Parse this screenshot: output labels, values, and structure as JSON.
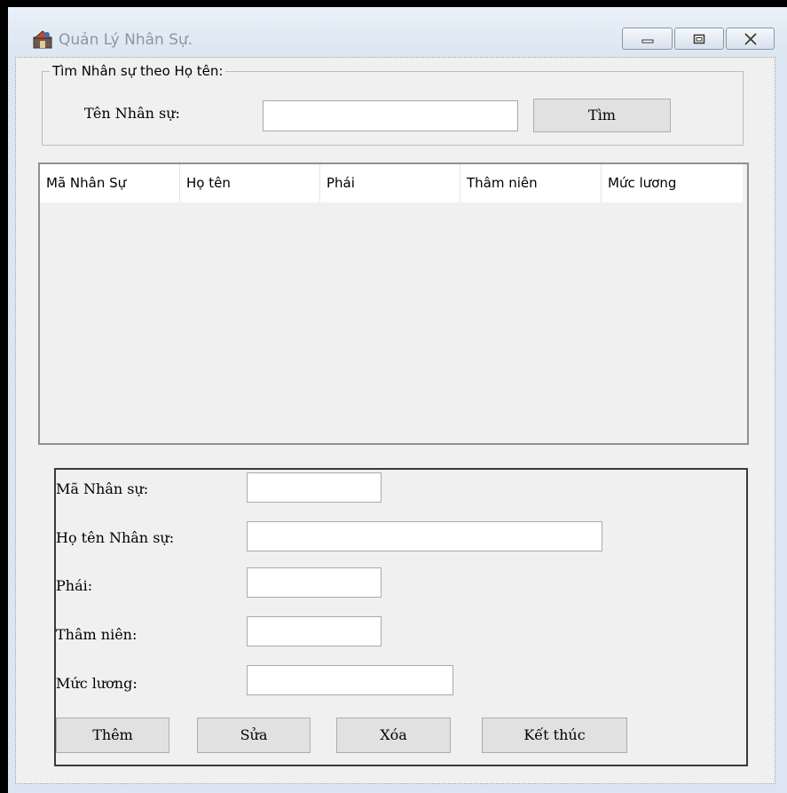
{
  "window": {
    "title": "Quản Lý Nhân Sự.",
    "controls": {
      "minimize": "minimize",
      "maximize": "maximize",
      "close": "close"
    }
  },
  "search": {
    "group_title": "Tìm Nhân sự theo Họ tên:",
    "label": "Tên Nhân sự:",
    "value": "",
    "button": "Tìm"
  },
  "list": {
    "columns": [
      "Mã Nhân Sự",
      "Họ tên",
      "Phái",
      "Thâm niên",
      "Mức lương"
    ],
    "rows": []
  },
  "details": {
    "ma_label": "Mã Nhân sự:",
    "ma_value": "",
    "hoten_label": "Họ tên Nhân sự:",
    "hoten_value": "",
    "phai_label": "Phái:",
    "phai_value": "",
    "tham_label": "Thâm niên:",
    "tham_value": "",
    "muc_label": "Mức lương:",
    "muc_value": ""
  },
  "actions": {
    "add": "Thêm",
    "edit": "Sửa",
    "delete": "Xóa",
    "exit": "Kết thúc"
  }
}
